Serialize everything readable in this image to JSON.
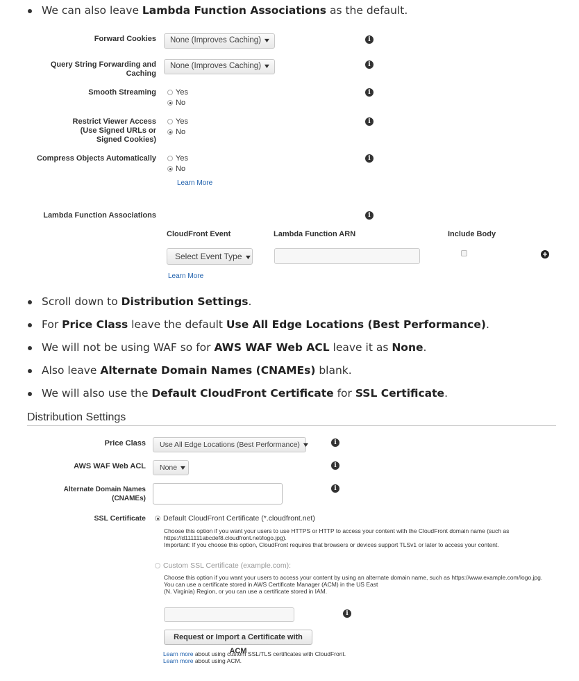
{
  "bullets_top": [
    {
      "pre": "We can also leave ",
      "bold": "Lambda Function Associations",
      "post": " as the default."
    }
  ],
  "cache_form": {
    "forward_cookies": {
      "label": "Forward Cookies",
      "value": "None (Improves Caching)"
    },
    "query_string": {
      "label_line1": "Query String Forwarding and",
      "label_line2": "Caching",
      "value": "None (Improves Caching)"
    },
    "smooth_streaming": {
      "label": "Smooth Streaming",
      "yes": "Yes",
      "no": "No"
    },
    "restrict_viewer": {
      "label_line1": "Restrict Viewer Access",
      "label_line2": "(Use Signed URLs or",
      "label_line3": "Signed Cookies)",
      "yes": "Yes",
      "no": "No"
    },
    "compress": {
      "label": "Compress Objects Automatically",
      "yes": "Yes",
      "no": "No",
      "learn_more": "Learn More"
    },
    "lambda": {
      "label": "Lambda Function Associations",
      "col_event": "CloudFront Event",
      "col_arn": "Lambda Function ARN",
      "col_body": "Include Body",
      "event_select": "Select Event Type",
      "arn_value": "",
      "learn_more": "Learn More"
    }
  },
  "bullets_mid": [
    {
      "parts": [
        {
          "t": "Scroll down to "
        },
        {
          "b": "Distribution Settings"
        },
        {
          "t": "."
        }
      ]
    },
    {
      "parts": [
        {
          "t": "For "
        },
        {
          "b": "Price Class"
        },
        {
          "t": " leave the default "
        },
        {
          "b": "Use All Edge Locations (Best Performance)"
        },
        {
          "t": "."
        }
      ]
    },
    {
      "parts": [
        {
          "t": "We will not be using WAF so for "
        },
        {
          "b": "AWS WAF Web ACL"
        },
        {
          "t": " leave it as "
        },
        {
          "b": "None"
        },
        {
          "t": "."
        }
      ]
    },
    {
      "parts": [
        {
          "t": "Also leave "
        },
        {
          "b": "Alternate Domain Names (CNAMEs)"
        },
        {
          "t": " blank."
        }
      ]
    },
    {
      "parts": [
        {
          "t": "We will also use the "
        },
        {
          "b": "Default CloudFront Certificate"
        },
        {
          "t": " for "
        },
        {
          "b": "SSL Certificate"
        },
        {
          "t": "."
        }
      ]
    }
  ],
  "dist": {
    "heading": "Distribution Settings",
    "price_class": {
      "label": "Price Class",
      "value": "Use All Edge Locations (Best Performance)"
    },
    "waf": {
      "label": "AWS WAF Web ACL",
      "value": "None"
    },
    "cnames": {
      "label_line1": "Alternate Domain Names",
      "label_line2": "(CNAMEs)",
      "value": ""
    },
    "ssl": {
      "label": "SSL Certificate",
      "default_option": "Default CloudFront Certificate (*.cloudfront.net)",
      "default_desc1": "Choose this option if you want your users to use HTTPS or HTTP to access your content with the CloudFront domain name (such as",
      "default_desc2": "https://d111111abcdef8.cloudfront.net/logo.jpg).",
      "default_desc3": "Important: If you choose this option, CloudFront requires that browsers or devices support TLSv1 or later to access your content.",
      "custom_option": "Custom SSL Certificate (example.com):",
      "custom_desc1": "Choose this option if you want your users to access your content by using an alternate domain name, such as https://www.example.com/logo.jpg.",
      "custom_desc2": "You can use a certificate stored in AWS Certificate Manager (ACM) in the US East",
      "custom_desc3": "(N. Virginia) Region, or you can use a certificate stored in IAM.",
      "cert_value": "",
      "request_button": "Request or Import a Certificate with ACM",
      "learn_more1_link": "Learn more",
      "learn_more1_text": " about using custom SSL/TLS certificates with CloudFront.",
      "learn_more2_link": "Learn more",
      "learn_more2_text": " about using ACM."
    }
  },
  "colors": {
    "link": "#1a5dab",
    "divider": "#cccccc"
  }
}
